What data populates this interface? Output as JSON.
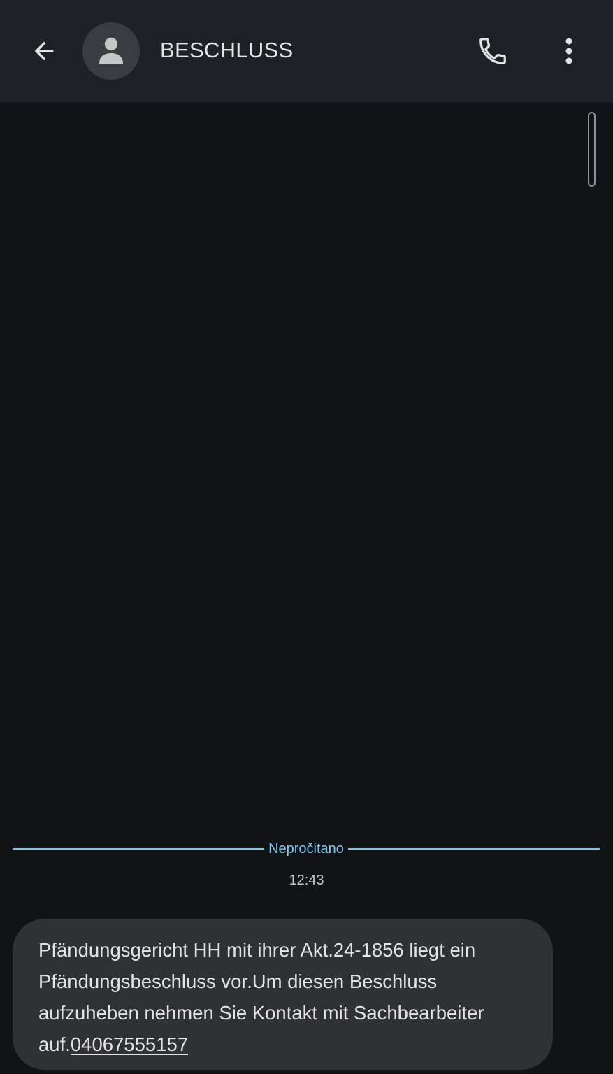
{
  "header": {
    "contact_name": "BESCHLUSS",
    "back_icon": "arrow-left-icon",
    "avatar_icon": "person-icon",
    "call_icon": "phone-icon",
    "more_icon": "more-vertical-icon"
  },
  "conversation": {
    "unread_label": "Nepročitano",
    "timestamp": "12:43",
    "messages": [
      {
        "text": "Pfändungsgericht HH mit ihrer Akt.24-1856 liegt ein Pfändungsbeschluss vor.Um diesen Beschluss aufzuheben nehmen Sie Kontakt mit Sachbearbeiter auf.",
        "link": "04067555157"
      }
    ]
  },
  "colors": {
    "app_bar": "#1e2125",
    "background": "#111417",
    "bubble": "#2f3134",
    "accent": "#7fc7ee",
    "text": "#e3e3e3"
  }
}
